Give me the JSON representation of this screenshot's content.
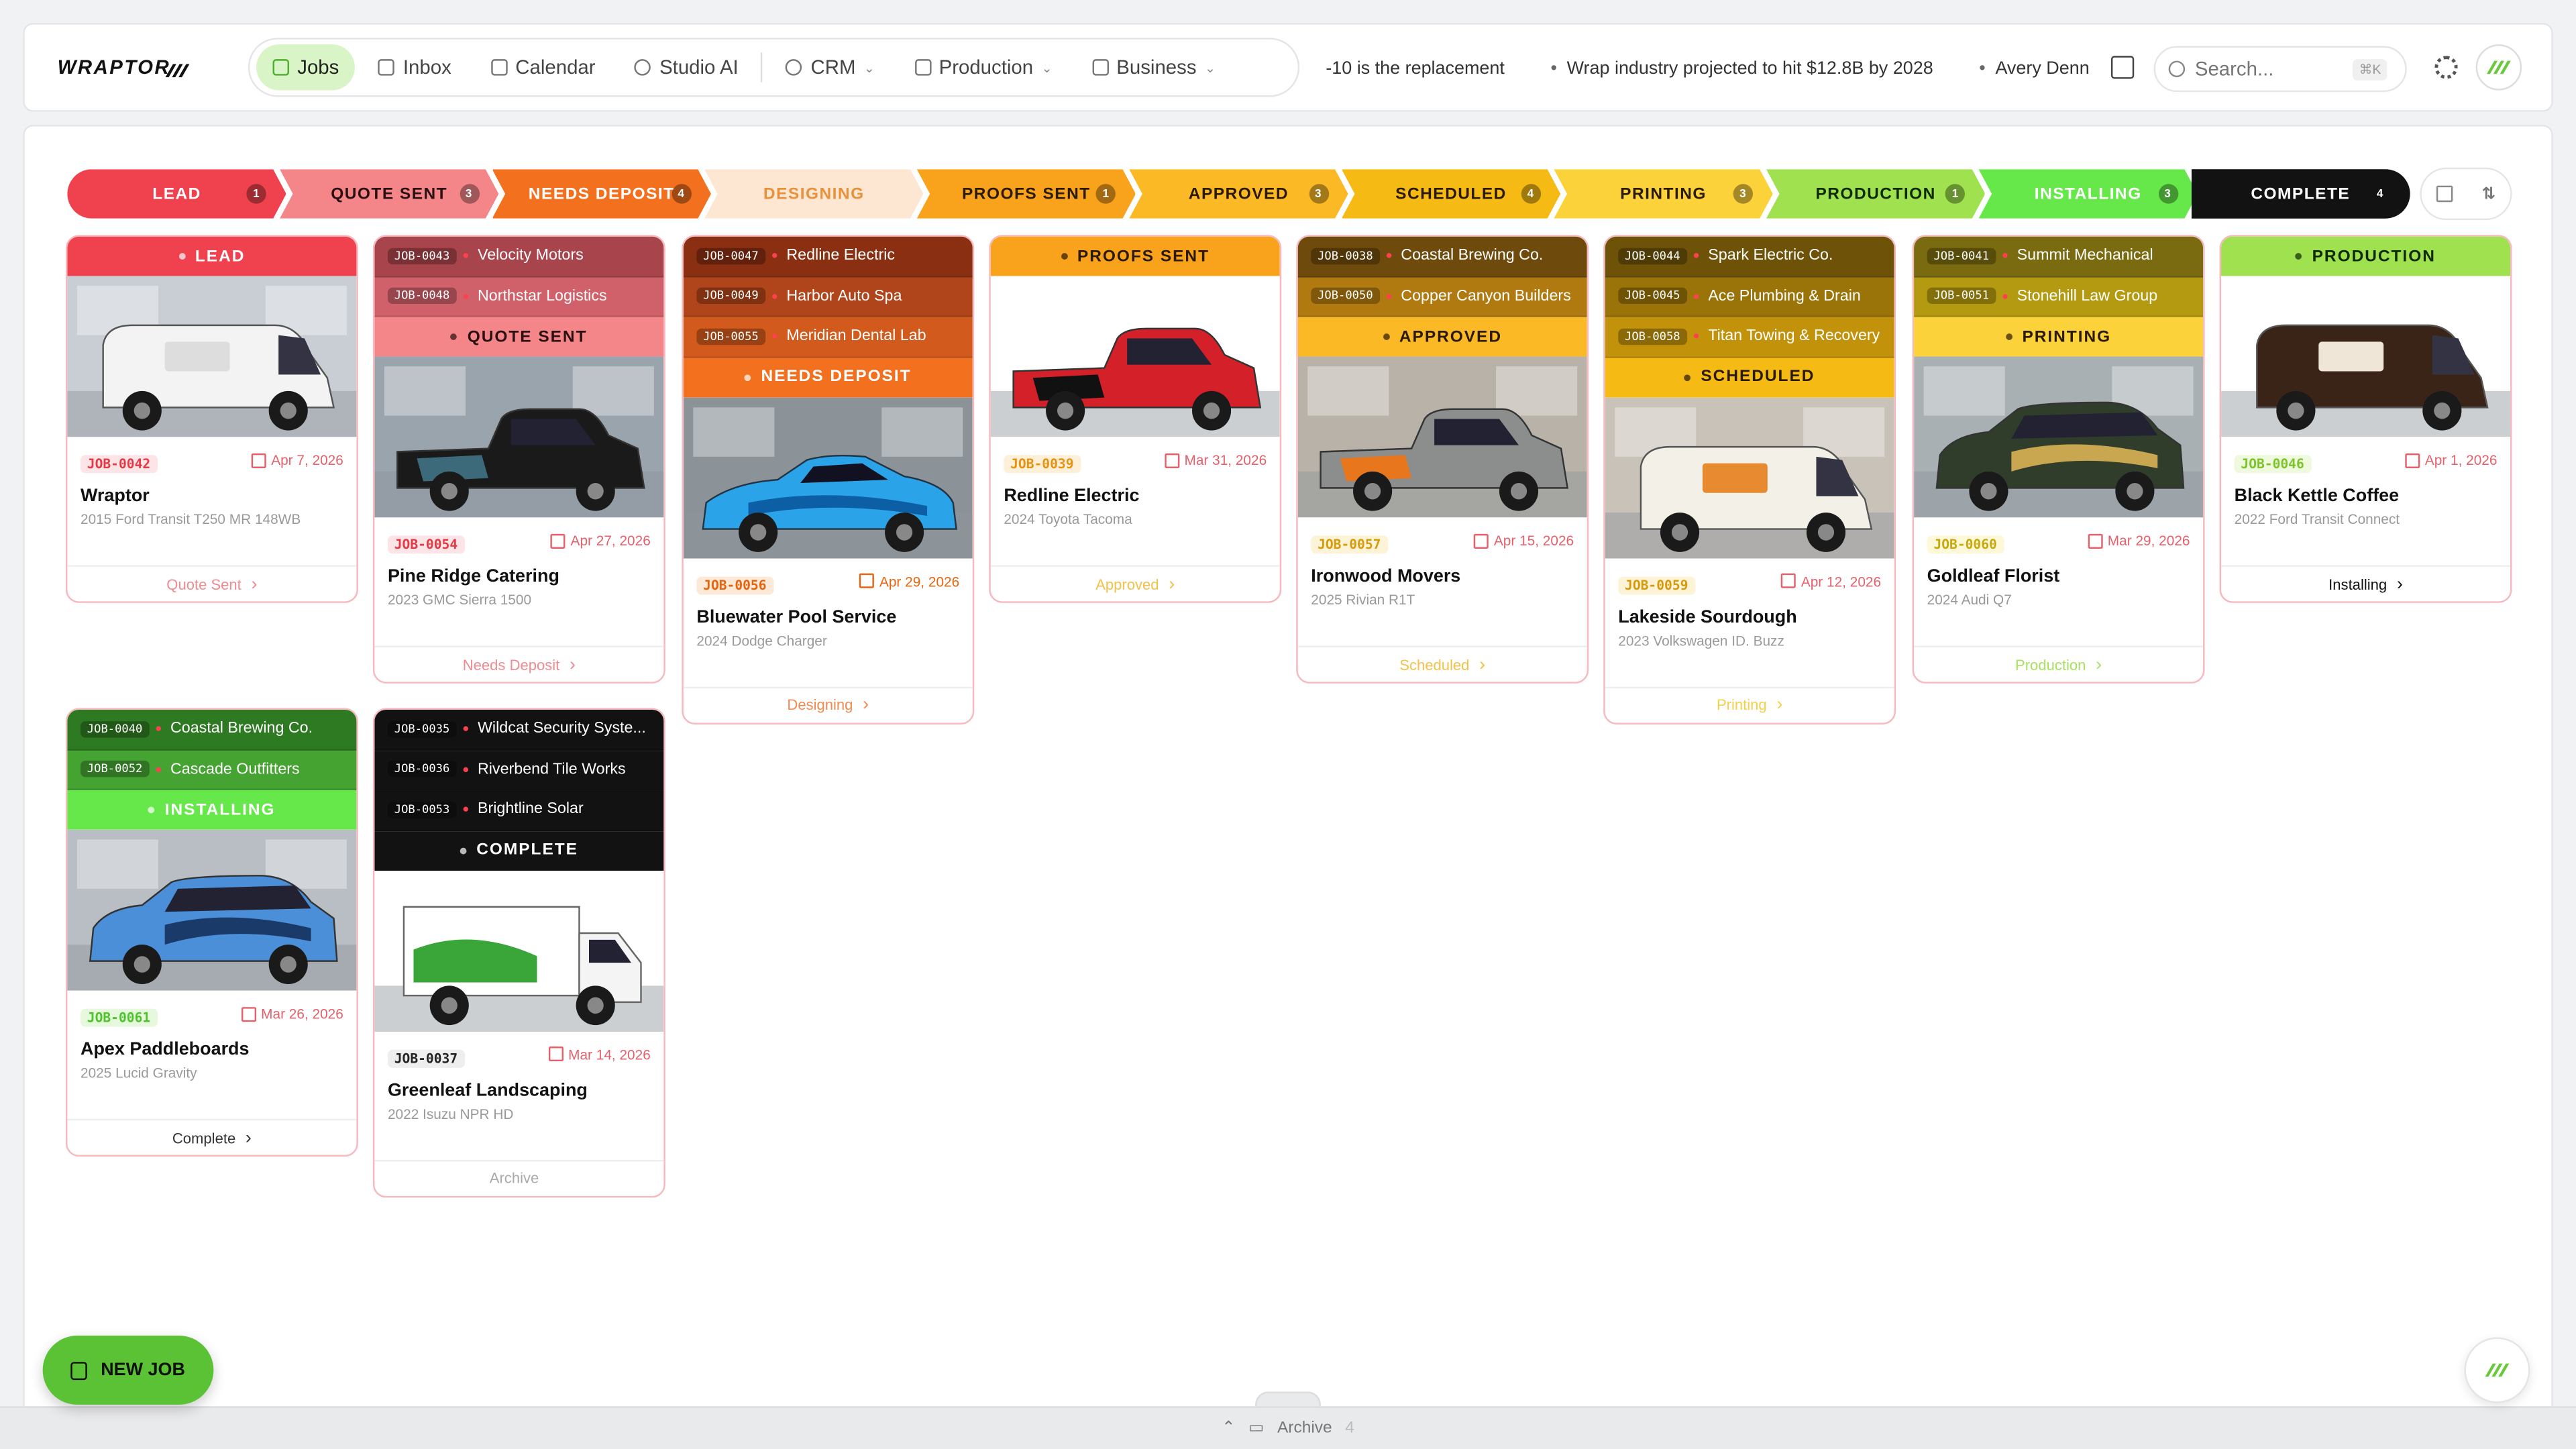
{
  "app": {
    "logo": "WRAPTOR"
  },
  "nav": [
    {
      "label": "Jobs",
      "active": true,
      "dropdown": false
    },
    {
      "label": "Inbox",
      "dropdown": false
    },
    {
      "label": "Calendar",
      "dropdown": false
    },
    {
      "label": "Studio AI",
      "dropdown": false
    },
    {
      "label": "CRM",
      "dropdown": true
    },
    {
      "label": "Production",
      "dropdown": true
    },
    {
      "label": "Business",
      "dropdown": true
    }
  ],
  "ticker": [
    "-10 is the replacement",
    "Wrap industry projected to hit $12.8B by 2028",
    "Avery Denn"
  ],
  "search": {
    "placeholder": "Search...",
    "shortcut": "⌘K"
  },
  "stages": [
    {
      "label": "LEAD",
      "count": "1",
      "bg": "#f0424e",
      "fg": "#ffffff"
    },
    {
      "label": "QUOTE SENT",
      "count": "3",
      "bg": "#f4868a",
      "fg": "#2a1010"
    },
    {
      "label": "NEEDS DEPOSIT",
      "count": "4",
      "bg": "#f3701f",
      "fg": "#ffffff"
    },
    {
      "label": "DESIGNING",
      "count": "",
      "bg": "#fde6d2",
      "fg": "#e8913a"
    },
    {
      "label": "PROOFS SENT",
      "count": "1",
      "bg": "#f9a21c",
      "fg": "#2a1a00"
    },
    {
      "label": "APPROVED",
      "count": "3",
      "bg": "#fbb925",
      "fg": "#2a1a00"
    },
    {
      "label": "SCHEDULED",
      "count": "4",
      "bg": "#f6ba14",
      "fg": "#2a1a00"
    },
    {
      "label": "PRINTING",
      "count": "3",
      "bg": "#fbd23a",
      "fg": "#2a1a00"
    },
    {
      "label": "PRODUCTION",
      "count": "1",
      "bg": "#9fe14e",
      "fg": "#102a00"
    },
    {
      "label": "INSTALLING",
      "count": "3",
      "bg": "#67e84a",
      "fg": "#ffffff"
    },
    {
      "label": "COMPLETE",
      "count": "4",
      "bg": "#121212",
      "fg": "#ffffff"
    }
  ],
  "cards": [
    {
      "stage": "LEAD",
      "strips": [],
      "header_bg": "#f0424e",
      "header_fg": "#ffffff",
      "job_id": "JOB-0042",
      "id_color": "#e53945",
      "id_bg": "#fde4e6",
      "date": "Apr 7, 2026",
      "date_color": "#e5606a",
      "customer": "Wraptor",
      "vehicle": "2015 Ford Transit T250 MR 148WB",
      "action": "Quote Sent",
      "action_color": "#f08a90",
      "vehicle_icon": "van-icon",
      "body": "#f3f3f3",
      "accent": "#dddddd",
      "garage": "#c9ced4",
      "shape": "van"
    },
    {
      "stage": "QUOTE SENT",
      "strips": [
        {
          "id": "JOB-0043",
          "name": "Velocity Motors",
          "bg": "#a8454c"
        },
        {
          "id": "JOB-0048",
          "name": "Northstar Logistics",
          "bg": "#d0616a"
        }
      ],
      "header_bg": "#f4868a",
      "header_fg": "#2a1010",
      "job_id": "JOB-0054",
      "id_color": "#e53945",
      "id_bg": "#fde4e6",
      "date": "Apr 27, 2026",
      "date_color": "#e5606a",
      "customer": "Pine Ridge Catering",
      "vehicle": "2023 GMC Sierra 1500",
      "action": "Needs Deposit",
      "action_color": "#f08a90",
      "vehicle_icon": "truck-icon",
      "body": "#1a1a1a",
      "accent": "#3d6a7a",
      "garage": "#9aa4ad",
      "shape": "truck"
    },
    {
      "stage": "NEEDS DEPOSIT",
      "strips": [
        {
          "id": "JOB-0047",
          "name": "Redline Electric",
          "bg": "#8a2f12"
        },
        {
          "id": "JOB-0049",
          "name": "Harbor Auto Spa",
          "bg": "#b0441a"
        },
        {
          "id": "JOB-0055",
          "name": "Meridian Dental Lab",
          "bg": "#d25a1c"
        }
      ],
      "header_bg": "#f3701f",
      "header_fg": "#ffffff",
      "job_id": "JOB-0056",
      "id_color": "#e8650f",
      "id_bg": "#fde9d8",
      "date": "Apr 29, 2026",
      "date_color": "#e8650f",
      "customer": "Bluewater Pool Service",
      "vehicle": "2024 Dodge Charger",
      "action": "Designing",
      "action_color": "#f08a50",
      "vehicle_icon": "car-icon",
      "body": "#2aa3e8",
      "accent": "#0d5fa5",
      "garage": "#8b9298",
      "shape": "car"
    },
    {
      "stage": "PROOFS SENT",
      "strips": [],
      "header_bg": "#f9a21c",
      "header_fg": "#2a1a00",
      "job_id": "JOB-0039",
      "id_color": "#e8920f",
      "id_bg": "#fdf0d8",
      "date": "Mar 31, 2026",
      "date_color": "#e5606a",
      "customer": "Redline Electric",
      "vehicle": "2024 Toyota Tacoma",
      "action": "Approved",
      "action_color": "#f4c04a",
      "vehicle_icon": "truck-icon",
      "body": "#d42028",
      "accent": "#111111",
      "garage": "#ffffff",
      "shape": "truck"
    },
    {
      "stage": "APPROVED",
      "strips": [
        {
          "id": "JOB-0038",
          "name": "Coastal Brewing Co.",
          "bg": "#6e4a0c"
        },
        {
          "id": "JOB-0050",
          "name": "Copper Canyon Builders",
          "bg": "#b07a10"
        }
      ],
      "header_bg": "#fbb925",
      "header_fg": "#2a1a00",
      "job_id": "JOB-0057",
      "id_color": "#d89a0a",
      "id_bg": "#fdf4d8",
      "date": "Apr 15, 2026",
      "date_color": "#e5606a",
      "customer": "Ironwood Movers",
      "vehicle": "2025 Rivian R1T",
      "action": "Scheduled",
      "action_color": "#f4c04a",
      "vehicle_icon": "truck-icon",
      "body": "#8c8e8e",
      "accent": "#e8761c",
      "garage": "#b8b2a8",
      "shape": "truck"
    },
    {
      "stage": "SCHEDULED",
      "strips": [
        {
          "id": "JOB-0044",
          "name": "Spark Electric Co.",
          "bg": "#6e5208"
        },
        {
          "id": "JOB-0045",
          "name": "Ace Plumbing & Drain",
          "bg": "#9a7408"
        },
        {
          "id": "JOB-0058",
          "name": "Titan Towing & Recovery",
          "bg": "#c2920a"
        }
      ],
      "header_bg": "#f6ba14",
      "header_fg": "#2a1a00",
      "job_id": "JOB-0059",
      "id_color": "#d89a0a",
      "id_bg": "#fdf4d8",
      "date": "Apr 12, 2026",
      "date_color": "#e5606a",
      "customer": "Lakeside Sourdough",
      "vehicle": "2023 Volkswagen ID. Buzz",
      "action": "Printing",
      "action_color": "#f4d04a",
      "vehicle_icon": "van-icon",
      "body": "#f3f0e8",
      "accent": "#e88a30",
      "garage": "#c9c2b8",
      "shape": "van"
    },
    {
      "stage": "PRINTING",
      "strips": [
        {
          "id": "JOB-0041",
          "name": "Summit Mechanical",
          "bg": "#7a6a10"
        },
        {
          "id": "JOB-0051",
          "name": "Stonehill Law Group",
          "bg": "#b49a10"
        }
      ],
      "header_bg": "#fbd23a",
      "header_fg": "#2a1a00",
      "job_id": "JOB-0060",
      "id_color": "#c8a80a",
      "id_bg": "#fdf8d8",
      "date": "Mar 29, 2026",
      "date_color": "#e5606a",
      "customer": "Goldleaf Florist",
      "vehicle": "2024 Audi Q7",
      "action": "Production",
      "action_color": "#a8e060",
      "vehicle_icon": "suv-icon",
      "body": "#2f3d2a",
      "accent": "#c9a650",
      "garage": "#a8b0b4",
      "shape": "suv"
    },
    {
      "stage": "PRODUCTION",
      "strips": [],
      "header_bg": "#9fe14e",
      "header_fg": "#102a00",
      "job_id": "JOB-0046",
      "id_color": "#7cc42a",
      "id_bg": "#eef9dd",
      "date": "Apr 1, 2026",
      "date_color": "#e5606a",
      "customer": "Black Kettle Coffee",
      "vehicle": "2022 Ford Transit Connect",
      "action": "Installing",
      "action_color": "#111111",
      "vehicle_icon": "van-icon",
      "body": "#3a2418",
      "accent": "#efe6d8",
      "garage": "#ffffff",
      "shape": "van"
    },
    {
      "stage": "INSTALLING",
      "strips": [
        {
          "id": "JOB-0040",
          "name": "Coastal Brewing Co.",
          "bg": "#2e7a22"
        },
        {
          "id": "JOB-0052",
          "name": "Cascade Outfitters",
          "bg": "#45a332"
        }
      ],
      "header_bg": "#67e84a",
      "header_fg": "#ffffff",
      "job_id": "JOB-0061",
      "id_color": "#4cc42a",
      "id_bg": "#e6f9dd",
      "date": "Mar 26, 2026",
      "date_color": "#e5606a",
      "customer": "Apex Paddleboards",
      "vehicle": "2025 Lucid Gravity",
      "action": "Complete",
      "action_color": "#333333",
      "vehicle_icon": "suv-icon",
      "body": "#4a8fd8",
      "accent": "#1a3a6a",
      "garage": "#b8bec4",
      "shape": "suv"
    },
    {
      "stage": "COMPLETE",
      "strips": [
        {
          "id": "JOB-0035",
          "name": "Wildcat Security Syste...",
          "bg": "#121212"
        },
        {
          "id": "JOB-0036",
          "name": "Riverbend Tile Works",
          "bg": "#121212"
        },
        {
          "id": "JOB-0053",
          "name": "Brightline Solar",
          "bg": "#121212"
        }
      ],
      "header_bg": "#121212",
      "header_fg": "#ffffff",
      "job_id": "JOB-0037",
      "id_color": "#222222",
      "id_bg": "#eeeeee",
      "date": "Mar 14, 2026",
      "date_color": "#e5606a",
      "customer": "Greenleaf Landscaping",
      "vehicle": "2022 Isuzu NPR HD",
      "action": "Archive",
      "action_color": "#aaaaaa",
      "vehicle_icon": "box-truck-icon",
      "body": "#ffffff",
      "accent": "#3aa63a",
      "garage": "#ffffff",
      "shape": "box"
    }
  ],
  "archive": {
    "label": "Archive",
    "count": "4"
  },
  "new_job_label": "NEW JOB"
}
